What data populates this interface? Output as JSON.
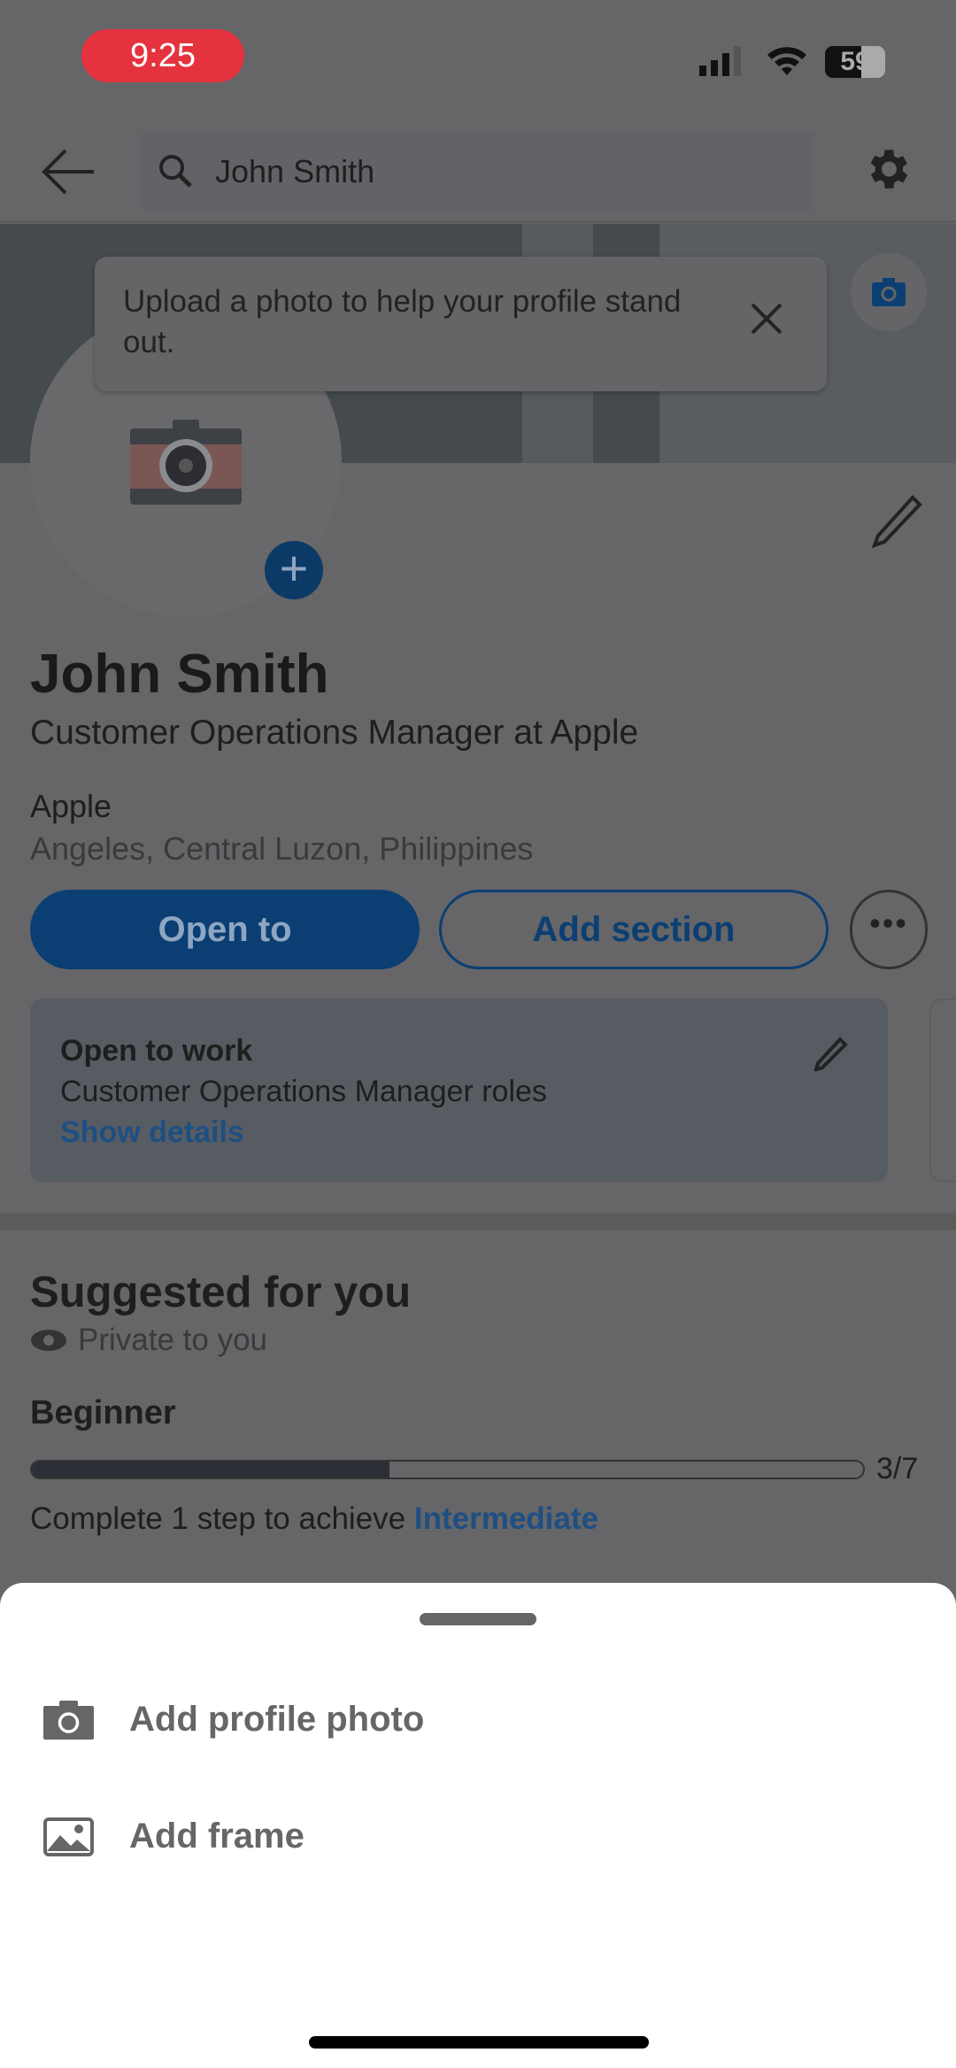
{
  "status": {
    "time": "9:25",
    "battery": "59"
  },
  "header": {
    "search_value": "John Smith"
  },
  "tooltip": {
    "text": "Upload a photo to help your profile stand out."
  },
  "profile": {
    "name": "John Smith",
    "headline": "Customer Operations Manager at Apple",
    "company": "Apple",
    "location": "Angeles, Central Luzon, Philippines"
  },
  "actions": {
    "open_to": "Open to",
    "add_section": "Add section"
  },
  "open_to_work": {
    "title": "Open to work",
    "roles": "Customer Operations Manager roles",
    "link": "Show details"
  },
  "suggested": {
    "title": "Suggested for you",
    "privacy": "Private to you",
    "level": "Beginner",
    "progress_label": "3/7",
    "progress_fraction": 0.43,
    "hint": "Complete 1 step to achieve",
    "next_level": "Intermediate"
  },
  "sheet": {
    "items": [
      {
        "label": "Add profile photo",
        "icon": "camera-icon"
      },
      {
        "label": "Add frame",
        "icon": "image-icon"
      }
    ]
  },
  "colors": {
    "accent": "#0b3f73",
    "link": "#1e5a94",
    "alert": "#e5323f"
  }
}
